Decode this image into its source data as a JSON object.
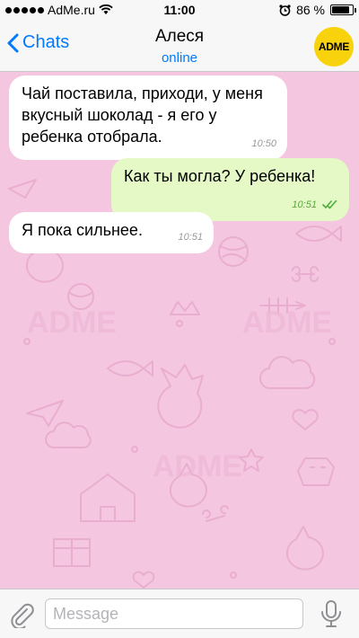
{
  "status_bar": {
    "carrier": "AdMe.ru",
    "time": "11:00",
    "battery_label": "86 %",
    "battery_level": 0.86
  },
  "nav": {
    "back_label": "Chats",
    "title": "Алеся",
    "subtitle": "online",
    "avatar_text": "ADME",
    "avatar_color": "#f8d20c",
    "accent_color": "#007aff"
  },
  "messages": [
    {
      "direction": "incoming",
      "text": "Чай поставила, приходи, у меня вкусный шоколад - я его у ребенка отобрала.",
      "time": "10:50"
    },
    {
      "direction": "outgoing",
      "text": "Как ты могла? У ребенка!",
      "time": "10:51",
      "status": "read"
    },
    {
      "direction": "incoming",
      "text": "Я пока сильнее.",
      "time": "10:51"
    }
  ],
  "composer": {
    "placeholder": "Message",
    "attach_icon": "paperclip-icon",
    "mic_icon": "microphone-icon"
  },
  "colors": {
    "background": "#f4c6e0",
    "incoming_bubble": "#ffffff",
    "outgoing_bubble": "#e4f9c6"
  }
}
